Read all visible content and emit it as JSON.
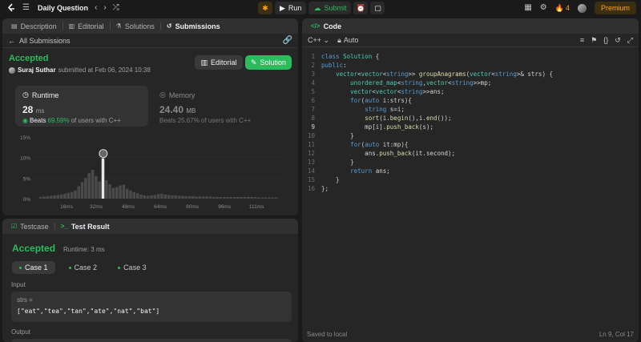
{
  "nav": {
    "title": "Daily Question",
    "run": "Run",
    "submit": "Submit",
    "streak_count": "4",
    "premium": "Premium"
  },
  "left_tabs": [
    {
      "label": "Description",
      "icon": "description-icon"
    },
    {
      "label": "Editorial",
      "icon": "book-icon"
    },
    {
      "label": "Solutions",
      "icon": "flask-icon"
    },
    {
      "label": "Submissions",
      "icon": "history-icon"
    }
  ],
  "submission": {
    "back_label": "All Submissions",
    "status": "Accepted",
    "author": "Suraj Suthar",
    "submitted_at": "submitted at Feb 06, 2024 10:38",
    "editorial_btn": "Editorial",
    "solution_btn": "Solution"
  },
  "runtime": {
    "label": "Runtime",
    "value": "28",
    "unit": "ms",
    "beats_prefix": "Beats",
    "beats_pct": "69.59%",
    "beats_suffix": "of users with C++"
  },
  "memory": {
    "label": "Memory",
    "value": "24.40",
    "unit": "MB",
    "beats": "Beats 25.67% of users with C++"
  },
  "chart_data": {
    "type": "bar",
    "y_ticks": [
      "15%",
      "10%",
      "5%",
      "0%"
    ],
    "x_ticks": [
      "16ms",
      "32ms",
      "48ms",
      "64ms",
      "80ms",
      "96ms",
      "111ms"
    ],
    "ylim": [
      0,
      15
    ],
    "values": [
      0.4,
      0.5,
      0.6,
      0.7,
      0.8,
      0.9,
      1.0,
      1.2,
      1.4,
      1.6,
      2.0,
      3.0,
      4.0,
      5.0,
      6.2,
      7.0,
      5.5,
      4.2,
      9.8,
      4.5,
      3.5,
      2.6,
      2.8,
      3.2,
      3.4,
      2.4,
      2.0,
      1.6,
      1.3,
      1.0,
      0.8,
      0.7,
      0.8,
      0.9,
      1.1,
      1.2,
      1.0,
      0.9,
      0.8,
      0.8,
      0.7,
      0.7,
      0.6,
      0.6,
      0.6,
      0.5,
      0.5,
      0.5,
      0.5,
      0.5,
      0.4,
      0.4,
      0.4,
      0.4,
      0.4,
      0.4,
      0.4,
      0.4,
      0.4,
      0.4,
      0.4,
      0.4,
      0.4,
      0.3,
      0.3,
      0.3,
      0.3,
      0.3,
      0.3
    ],
    "highlight_index": 18
  },
  "bottom_tabs": [
    {
      "label": "Testcase",
      "icon": "checkbox-icon"
    },
    {
      "label": "Test Result",
      "icon": "terminal-icon"
    }
  ],
  "result": {
    "status": "Accepted",
    "runtime": "Runtime: 3 ms",
    "cases": [
      "Case 1",
      "Case 2",
      "Case 3"
    ],
    "input_label": "Input",
    "var_name": "strs =",
    "var_value": "[\"eat\",\"tea\",\"tan\",\"ate\",\"nat\",\"bat\"]",
    "output_label": "Output"
  },
  "code_panel": {
    "tab": "Code",
    "language": "C++",
    "auto": "Auto",
    "saved": "Saved to local",
    "cursor": "Ln 9, Col 17",
    "current_line": 9,
    "lines": [
      "class Solution {",
      "public:",
      "    vector<vector<string>> groupAnagrams(vector<string>& strs) {",
      "        unordered_map<string,vector<string>>mp;",
      "        vector<vector<string>>ans;",
      "        for(auto i:strs){",
      "            string s=i;",
      "            sort(i.begin(),i.end());",
      "            mp[i].push_back(s);",
      "        }",
      "        for(auto it:mp){",
      "            ans.push_back(it.second);",
      "        }",
      "        return ans;",
      "    }",
      "};"
    ]
  },
  "colors": {
    "accent_green": "#2cbb5d",
    "accent_orange": "#ffa116",
    "panel": "#262626"
  }
}
